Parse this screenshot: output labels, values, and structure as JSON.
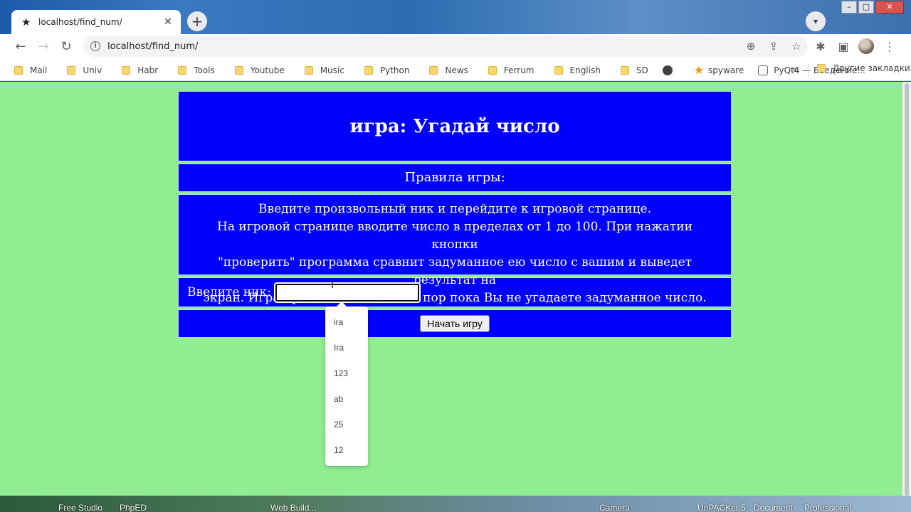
{
  "browser": {
    "tab_title": "localhost/find_num/",
    "tab_close": "✕",
    "new_tab": "+",
    "url": "localhost/find_num/",
    "bookmarks": [
      {
        "label": "Mail",
        "kind": "folder"
      },
      {
        "label": "Univ",
        "kind": "folder"
      },
      {
        "label": "Habr",
        "kind": "folder"
      },
      {
        "label": "Tools",
        "kind": "folder"
      },
      {
        "label": "Youtube",
        "kind": "folder"
      },
      {
        "label": "Music",
        "kind": "folder"
      },
      {
        "label": "Python",
        "kind": "folder"
      },
      {
        "label": "News",
        "kind": "folder"
      },
      {
        "label": "Ferrum",
        "kind": "folder"
      },
      {
        "label": "English",
        "kind": "folder"
      },
      {
        "label": "SD",
        "kind": "folder"
      },
      {
        "label": "",
        "kind": "globe"
      },
      {
        "label": "spyware",
        "kind": "star"
      },
      {
        "label": "PyQt4 — Введение...",
        "kind": "pyqt"
      }
    ],
    "bookmarks_more": "»",
    "other_bookmarks": "Другие закладки"
  },
  "page": {
    "title": "игра: Угадай число",
    "rules_heading": "Правила игры:",
    "rules_lines": [
      "Введите произвольный ник и перейдите к игровой странице.",
      "На игровой странице вводите число в пределах от 1 до 100. При нажатии кнопки",
      "\"проверить\" программа сравнит задуманное ею число с вашим и выведет результат на",
      "экран. Игра продолжается до тех пор пока Вы не угадаете задуманное число."
    ],
    "nick_label": "Введите ник:",
    "nick_value": "",
    "start_button": "Начать игру",
    "autocomplete": [
      "ira",
      "Ira",
      "123",
      "ab",
      "25",
      "12"
    ]
  },
  "taskbar": [
    "Free Studio",
    "PhpED",
    "Web Build...",
    "Camera",
    "UnPACKer 5",
    "Document",
    "Professional"
  ],
  "colors": {
    "page_bg": "#90ee90",
    "panel_bg": "#0000ff",
    "panel_text": "#ffffff"
  }
}
